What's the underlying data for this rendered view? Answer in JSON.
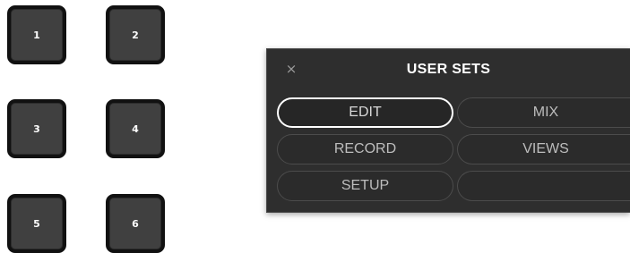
{
  "pads": [
    {
      "label": "1"
    },
    {
      "label": "2"
    },
    {
      "label": "3"
    },
    {
      "label": "4"
    },
    {
      "label": "5"
    },
    {
      "label": "6"
    }
  ],
  "user_sets_panel": {
    "title": "USER SETS",
    "close_icon": "×",
    "buttons": [
      {
        "label": "EDIT",
        "selected": true
      },
      {
        "label": "MIX",
        "selected": false
      },
      {
        "label": "RECORD",
        "selected": false
      },
      {
        "label": "VIEWS",
        "selected": false
      },
      {
        "label": "SETUP",
        "selected": false
      },
      {
        "label": "",
        "selected": false
      }
    ]
  },
  "colors": {
    "pad_fill": "#404040",
    "pad_border": "#111111",
    "panel_bg": "#2e2e2e",
    "button_border": "#4c4c4c",
    "selected_border": "#ffffff"
  }
}
